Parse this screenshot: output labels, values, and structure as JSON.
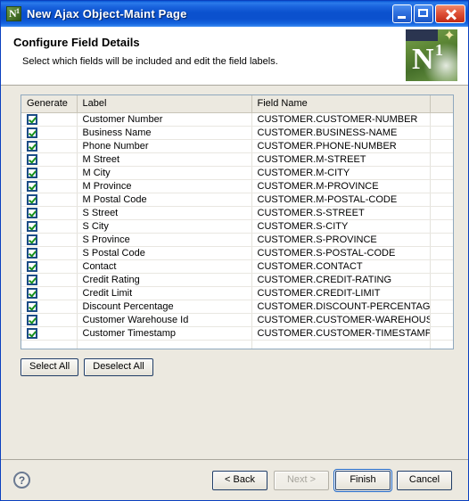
{
  "window": {
    "title": "New Ajax Object-Maint Page",
    "icon": "app-n1-icon",
    "controls": {
      "minimize": "minimize-icon",
      "maximize": "maximize-icon",
      "close": "close-icon"
    }
  },
  "banner": {
    "title": "Configure Field Details",
    "subtitle": "Select which fields will be included and edit the field labels.",
    "logo_letter": "N",
    "logo_sup": "1",
    "logo_sparkle": "✦"
  },
  "table": {
    "columns": [
      "Generate",
      "Label",
      "Field Name",
      ""
    ],
    "rows": [
      {
        "generate": true,
        "label": "Customer Number",
        "field_name": "CUSTOMER.CUSTOMER-NUMBER"
      },
      {
        "generate": true,
        "label": "Business Name",
        "field_name": "CUSTOMER.BUSINESS-NAME"
      },
      {
        "generate": true,
        "label": "Phone Number",
        "field_name": "CUSTOMER.PHONE-NUMBER"
      },
      {
        "generate": true,
        "label": "M Street",
        "field_name": "CUSTOMER.M-STREET"
      },
      {
        "generate": true,
        "label": "M City",
        "field_name": "CUSTOMER.M-CITY"
      },
      {
        "generate": true,
        "label": "M Province",
        "field_name": "CUSTOMER.M-PROVINCE"
      },
      {
        "generate": true,
        "label": "M Postal Code",
        "field_name": "CUSTOMER.M-POSTAL-CODE"
      },
      {
        "generate": true,
        "label": "S Street",
        "field_name": "CUSTOMER.S-STREET"
      },
      {
        "generate": true,
        "label": "S City",
        "field_name": "CUSTOMER.S-CITY"
      },
      {
        "generate": true,
        "label": "S Province",
        "field_name": "CUSTOMER.S-PROVINCE"
      },
      {
        "generate": true,
        "label": "S Postal Code",
        "field_name": "CUSTOMER.S-POSTAL-CODE"
      },
      {
        "generate": true,
        "label": "Contact",
        "field_name": "CUSTOMER.CONTACT"
      },
      {
        "generate": true,
        "label": "Credit Rating",
        "field_name": "CUSTOMER.CREDIT-RATING"
      },
      {
        "generate": true,
        "label": "Credit Limit",
        "field_name": "CUSTOMER.CREDIT-LIMIT"
      },
      {
        "generate": true,
        "label": "Discount Percentage",
        "field_name": "CUSTOMER.DISCOUNT-PERCENTAGE"
      },
      {
        "generate": true,
        "label": "Customer Warehouse Id",
        "field_name": "CUSTOMER.CUSTOMER-WAREHOUS..."
      },
      {
        "generate": true,
        "label": "Customer Timestamp",
        "field_name": "CUSTOMER.CUSTOMER-TIMESTAMP"
      },
      {
        "generate": false,
        "label": "",
        "field_name": ""
      }
    ]
  },
  "selection_buttons": {
    "select_all": "Select All",
    "deselect_all": "Deselect All"
  },
  "footer": {
    "help": "?",
    "back": "< Back",
    "next": "Next >",
    "finish": "Finish",
    "cancel": "Cancel"
  },
  "colors": {
    "titlebar_blue": "#0B51CE",
    "body_beige": "#ECE9E0",
    "checkbox_border": "#1B4C86",
    "checkbox_check": "#17901C",
    "close_red": "#C02A14",
    "logo_green": "#5E8836"
  }
}
